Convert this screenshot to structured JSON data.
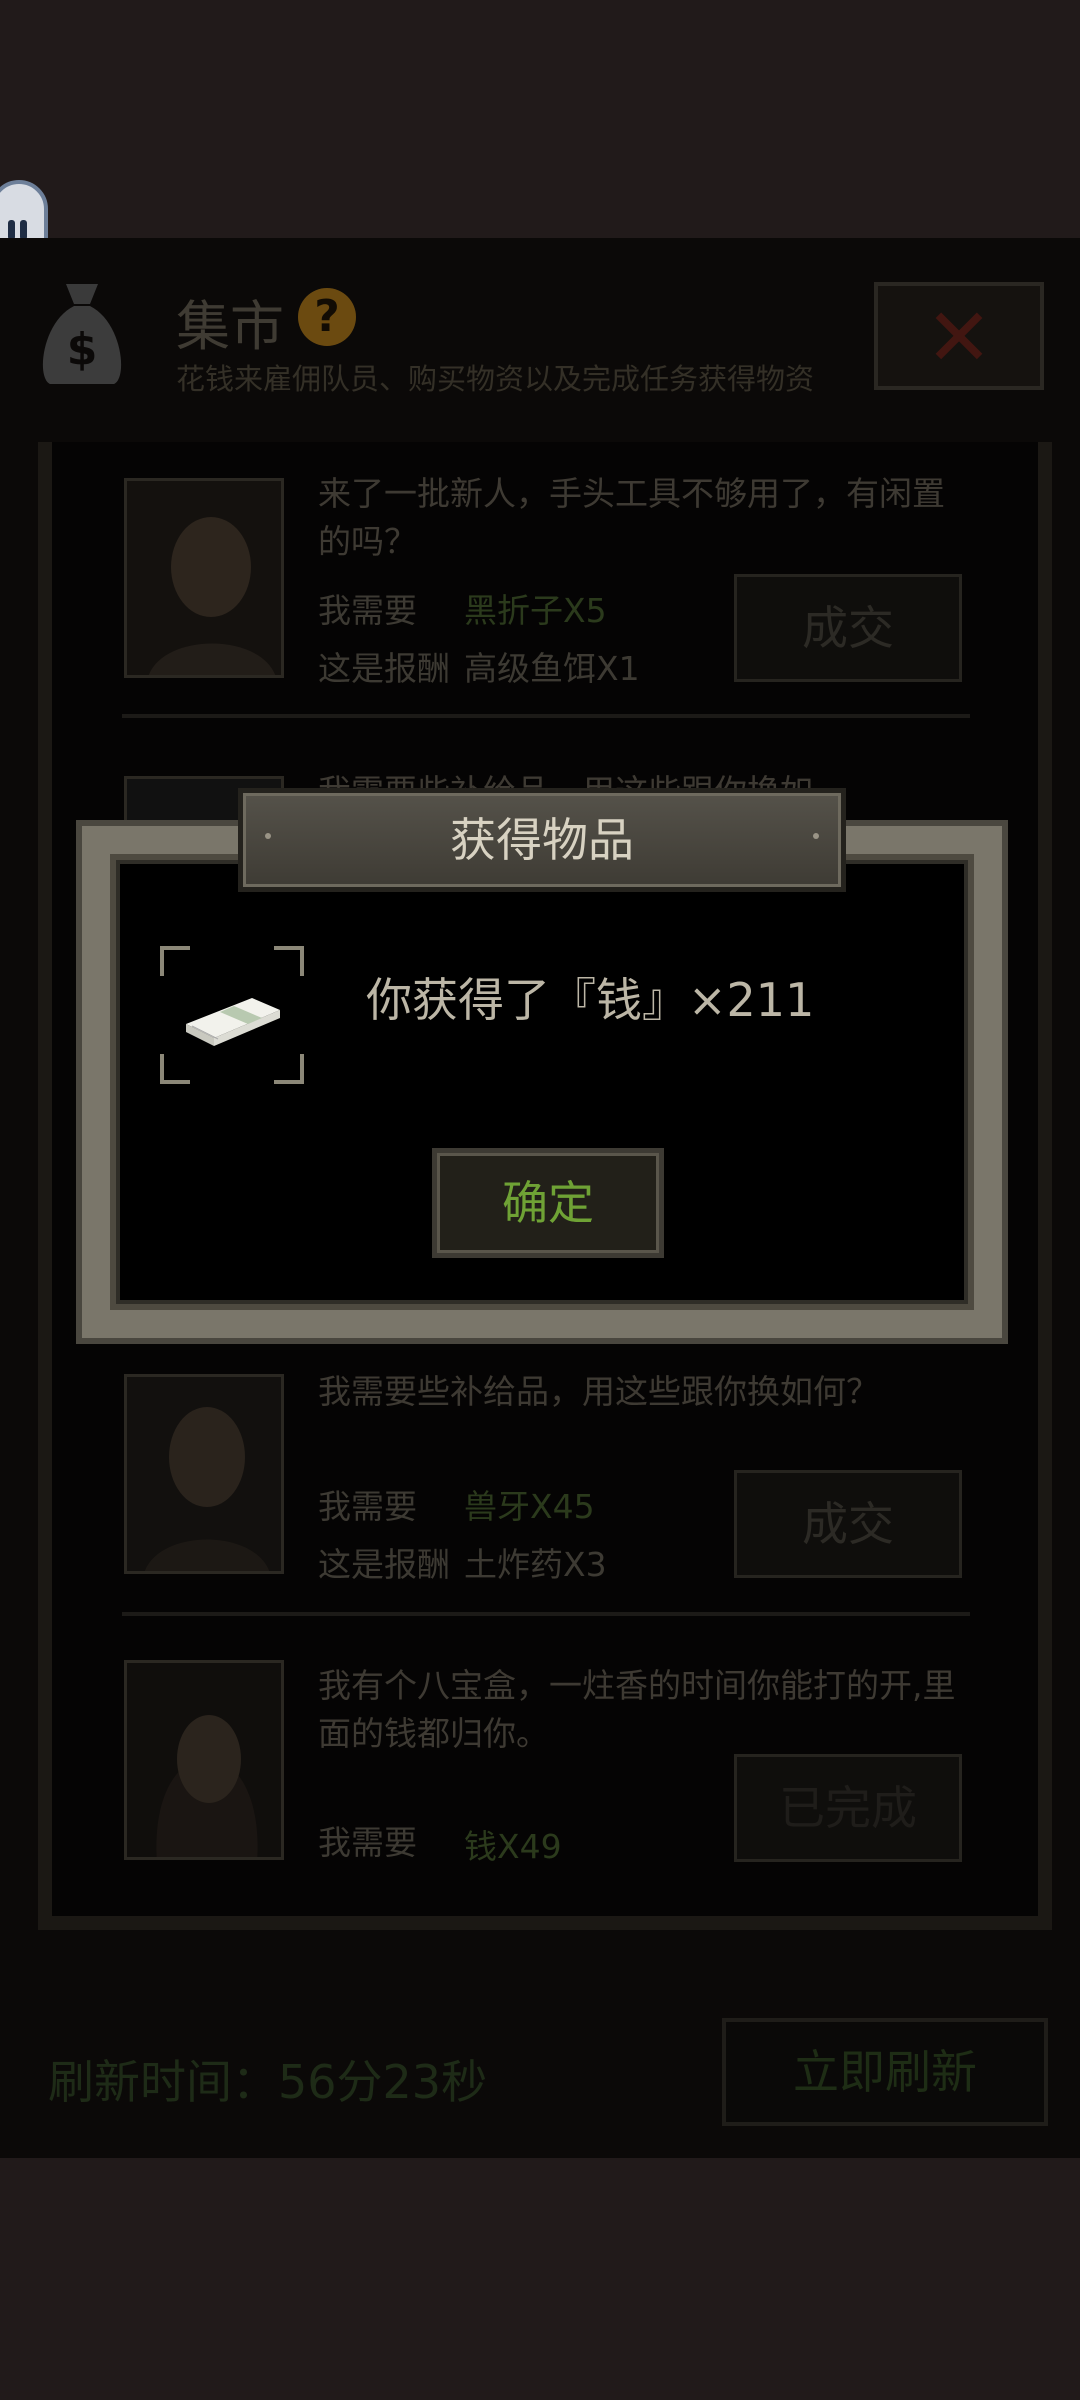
{
  "header": {
    "title": "集市",
    "subtitle": "花钱来雇佣队员、购买物资以及完成任务获得物资"
  },
  "trades": [
    {
      "message": "来了一批新人，手头工具不够用了，有闲置的吗？",
      "need_label": "我需要",
      "need_value": "黑折子X5",
      "reward_label": "这是报酬",
      "reward_value": "高级鱼饵X1",
      "button": "成交"
    },
    {
      "message": "我需要些补给品，用这些跟你换如何？",
      "need_label": "我需要",
      "need_value": "兽牙X45",
      "reward_label": "这是报酬",
      "reward_value": "土炸药X3",
      "button": "成交"
    },
    {
      "message": "我有个八宝盒，一炷香的时间你能打的开,里面的钱都归你。",
      "need_label": "我需要",
      "need_value": "钱X49",
      "button": "已完成"
    }
  ],
  "partial_trade_text": "我需要些补给品，用这些跟你换如何？",
  "footer": {
    "refresh_time": "刷新时间：56分23秒",
    "refresh_button": "立即刷新"
  },
  "modal": {
    "title": "获得物品",
    "reward_text": "你获得了『钱』×211",
    "confirm": "确定",
    "item_icon": "cash-stack-icon"
  },
  "colors": {
    "confirm_text": "#6fa235",
    "need_value": "#2b3a1c",
    "modal_border": "#7a766a"
  }
}
